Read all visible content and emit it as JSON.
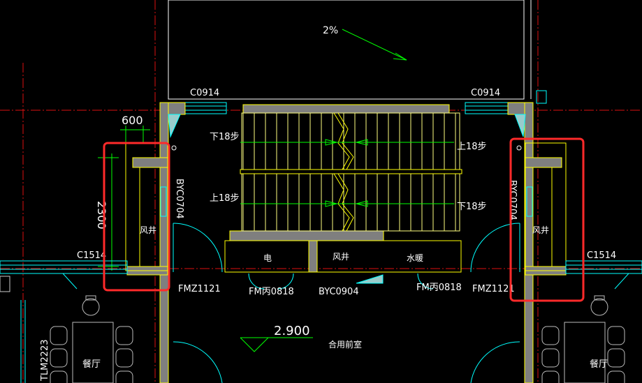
{
  "labels": {
    "slope": "2%",
    "window_top_left": "C0914",
    "window_top_right": "C0914",
    "dim_600": "600",
    "dim_2300": "2300",
    "stair_down_left": "下18步",
    "stair_up_right_top": "上18步",
    "stair_up_left": "上18步",
    "stair_down_right": "下18步",
    "byc_left": "BYC0704",
    "byc_right": "BYC0704",
    "shaft_left": "风井",
    "shaft_right": "风井",
    "shaft_center": "风井",
    "electric": "电",
    "water_heating": "水暖",
    "window_left": "C1514",
    "window_right": "C1514",
    "door_left": "FMZ1121",
    "door_right": "FMZ1121",
    "fm_left": "FM丙0818",
    "fm_right": "FM丙0818",
    "byc_bottom": "BYC0904",
    "elevation": "2.900",
    "lobby": "合用前室",
    "tlm": "TLM2223",
    "dining_left": "餐厅",
    "dining_right": "餐厅"
  },
  "colors": {
    "background": "#000000",
    "wall_fill": "#808080",
    "wall_line": "#ffff00",
    "axis": "#ff0000",
    "text": "#ffffff",
    "dimension": "#00ff00",
    "highlight": "#ff2020",
    "furniture": "#c0c0c0",
    "window": "#00ffff",
    "stair": "#ffff80"
  }
}
